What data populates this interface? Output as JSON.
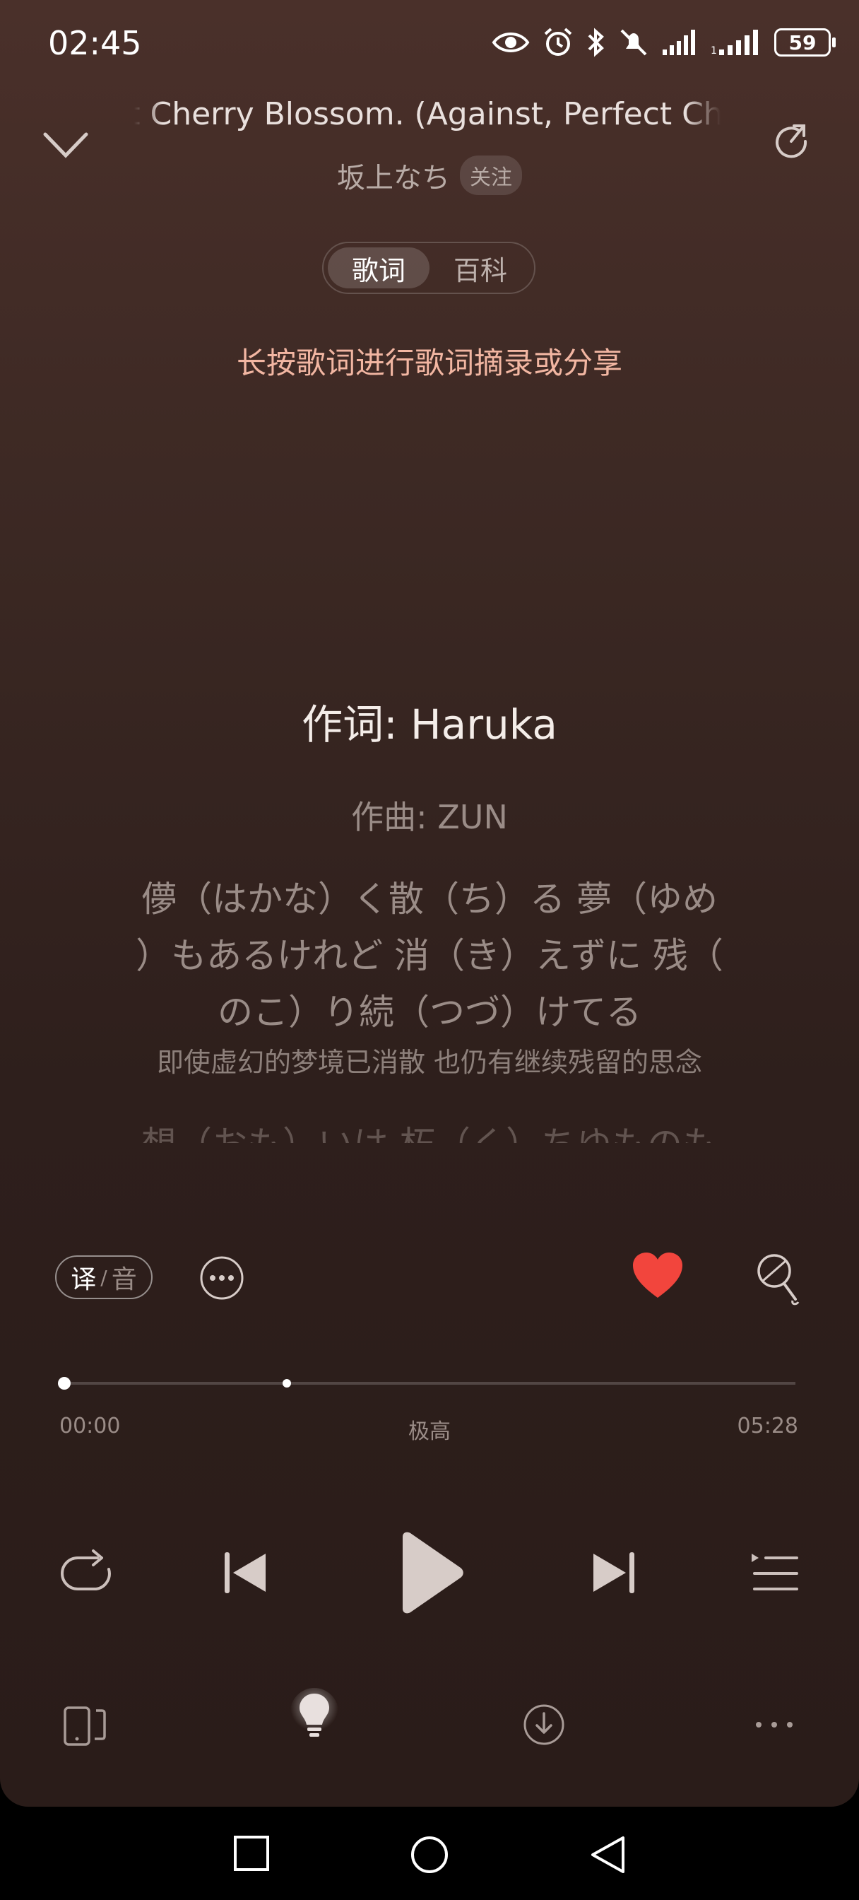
{
  "status_bar": {
    "time": "02:45",
    "battery": "59",
    "icons": [
      "eye-icon",
      "alarm-icon",
      "bluetooth-icon",
      "mute-icon",
      "signal-icon",
      "signal-icon"
    ]
  },
  "header": {
    "title": "ect Cherry Blossom. (Against, Perfect Cherry Blossom.)",
    "artist": "坂上なち",
    "follow_label": "关注"
  },
  "tabs": [
    {
      "label": "歌词",
      "active": true
    },
    {
      "label": "百科",
      "active": false
    }
  ],
  "hint": "长按歌词进行歌词摘录或分享",
  "lyrics": {
    "lyricist": "作词: Haruka",
    "composer": "作曲: ZUN",
    "verse_line1": "儚（はかな）く散（ち）る 夢（ゆめ",
    "verse_line2": "）もあるけれど 消（き）えずに 残（",
    "verse_line3": "のこ）り続（つづ）けてる",
    "translation": "即使虚幻的梦境已消散 也仍有继续残留的思念",
    "next_line": "想（おも）いは 朽（く）ちゆものも"
  },
  "tools": {
    "translate_label": "译",
    "separator": "/",
    "phonetic_label": "音"
  },
  "progress": {
    "current": "00:00",
    "quality": "极高",
    "duration": "05:28",
    "played_fraction": 0.0,
    "buffered_fraction": 0.3
  },
  "colors": {
    "accent_heart": "#f2453d",
    "hint": "#f2b6a2",
    "background_top": "#4a302a",
    "background_bottom": "#2a1c19"
  }
}
